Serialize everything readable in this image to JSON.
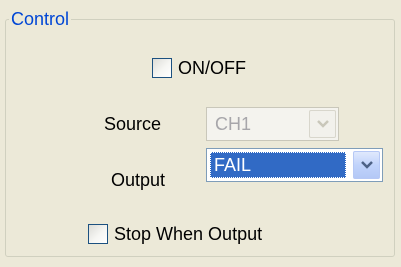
{
  "group": {
    "title": "Control"
  },
  "on_off": {
    "label": "ON/OFF",
    "checked": false
  },
  "source": {
    "label": "Source",
    "value": "CH1",
    "enabled": false
  },
  "output": {
    "label": "Output",
    "value": "FAIL",
    "enabled": true
  },
  "stop_when_output": {
    "label": "Stop When Output",
    "checked": false
  },
  "icons": {
    "dropdown": "chevron-down-icon"
  },
  "colors": {
    "group_title": "#0046d5",
    "selection": "#316ac5",
    "disabled_text": "#a7a6aa",
    "checkbox_border": "#1c5180",
    "background": "#ece9d8"
  }
}
